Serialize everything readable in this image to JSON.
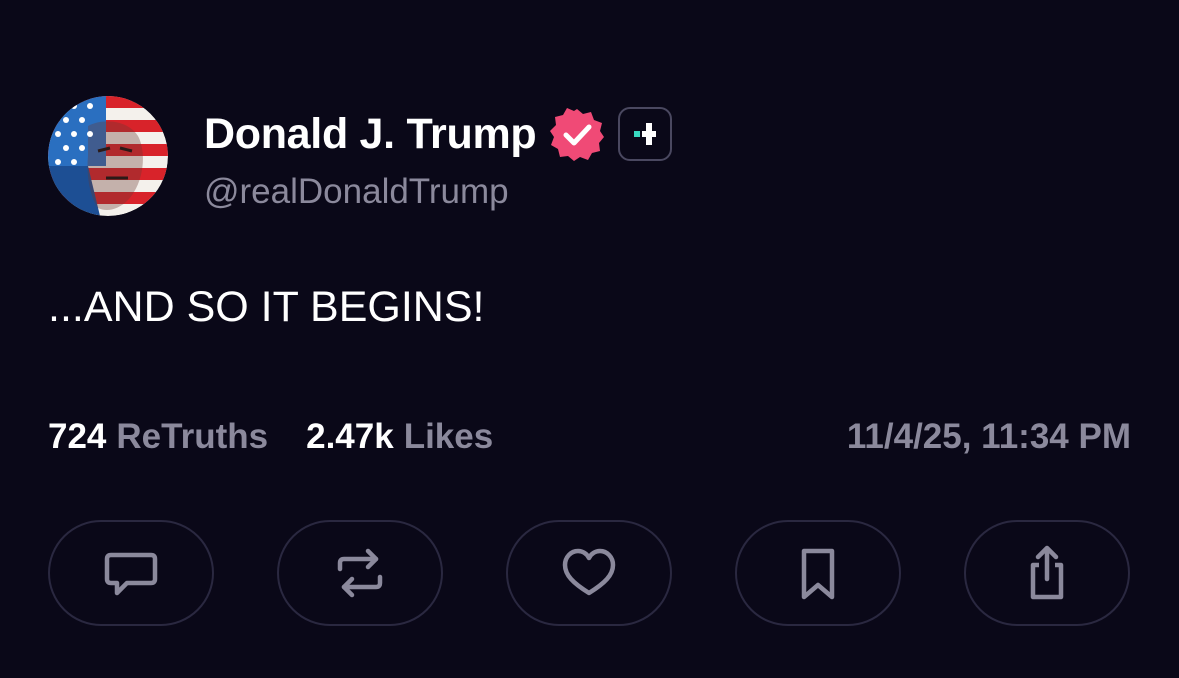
{
  "author": {
    "display_name": "Donald J. Trump",
    "handle": "@realDonaldTrump",
    "avatar_icon": "flag-portrait-avatar",
    "verified_icon": "verified-check-badge-icon",
    "plus_icon": "truth-plus-badge-icon"
  },
  "post": {
    "text": "...AND SO IT BEGINS!"
  },
  "stats": {
    "retruths_count": "724",
    "retruths_label": "ReTruths",
    "likes_count": "2.47k",
    "likes_label": "Likes",
    "timestamp": "11/4/25, 11:34 PM"
  },
  "actions": [
    {
      "name": "reply",
      "icon": "speech-bubble-icon"
    },
    {
      "name": "retruth",
      "icon": "repost-arrows-icon"
    },
    {
      "name": "like",
      "icon": "heart-icon"
    },
    {
      "name": "bookmark",
      "icon": "bookmark-icon"
    },
    {
      "name": "share",
      "icon": "share-icon"
    }
  ],
  "colors": {
    "background": "#0a0818",
    "text_primary": "#ffffff",
    "text_secondary": "#8b899c",
    "verified_badge": "#f04a76",
    "plus_accent": "#38d9c0",
    "button_border": "#2a2840"
  }
}
